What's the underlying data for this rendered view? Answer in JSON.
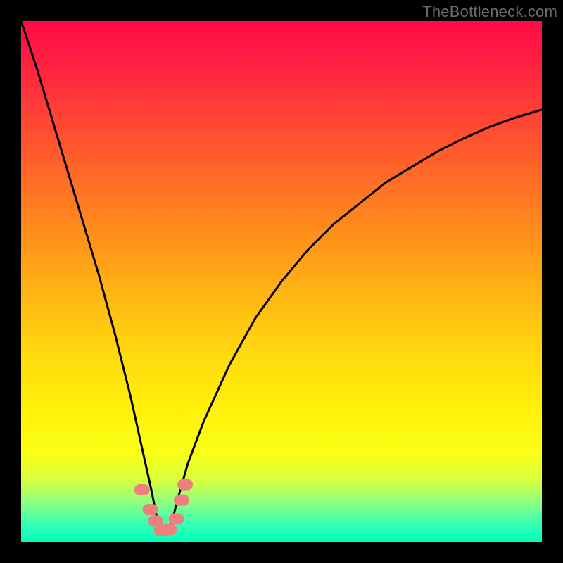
{
  "watermark": "TheBottleneck.com",
  "colors": {
    "frame_bg": "#000000",
    "curve_stroke": "#000000",
    "marker_fill": "#ed7f7c",
    "watermark_text": "#6b6b6b"
  },
  "chart_data": {
    "type": "line",
    "title": "",
    "xlabel": "",
    "ylabel": "",
    "xlim": [
      0,
      100
    ],
    "ylim": [
      0,
      100
    ],
    "note": "Bottleneck-style V-curve. y-axis is drawn with 100 at top, 0 at bottom (percentage mismatch). Minimum is near x≈27.",
    "series": [
      {
        "name": "bottleneck-curve",
        "x": [
          0,
          3,
          6,
          9,
          12,
          15,
          18,
          21,
          23,
          25,
          26,
          27,
          28,
          29,
          30,
          32,
          35,
          40,
          45,
          50,
          55,
          60,
          65,
          70,
          75,
          80,
          85,
          90,
          95,
          100
        ],
        "y": [
          100,
          91,
          81,
          71,
          61,
          51,
          40,
          28,
          19,
          10,
          5,
          2,
          2,
          4,
          8,
          15,
          23,
          34,
          43,
          50,
          56,
          61,
          65,
          69,
          72,
          75,
          77.5,
          79.7,
          81.5,
          83
        ]
      }
    ],
    "markers": [
      {
        "x": 23.2,
        "y": 10.0
      },
      {
        "x": 24.8,
        "y": 6.2
      },
      {
        "x": 25.8,
        "y": 4.0
      },
      {
        "x": 27.0,
        "y": 2.2
      },
      {
        "x": 28.4,
        "y": 2.4
      },
      {
        "x": 29.8,
        "y": 4.4
      },
      {
        "x": 30.8,
        "y": 8.0
      },
      {
        "x": 31.5,
        "y": 11.0
      }
    ]
  }
}
